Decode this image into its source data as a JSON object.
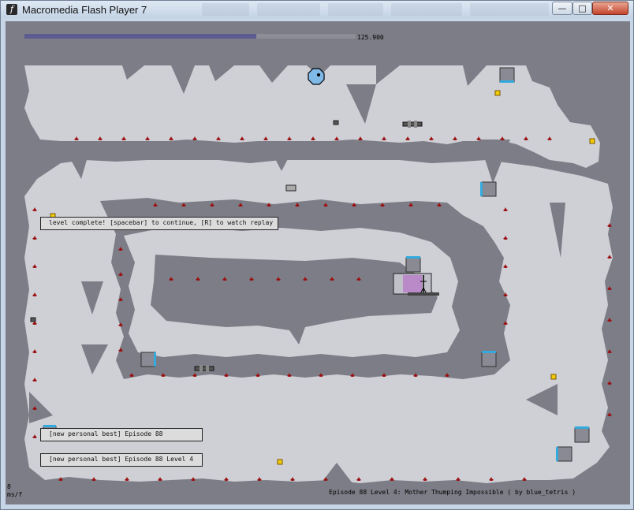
{
  "window": {
    "title": "Macromedia Flash Player 7",
    "app_icon_glyph": "f",
    "buttons": {
      "minimize": "—",
      "maximize": "□",
      "close": "✕"
    }
  },
  "hud": {
    "timer_value": "125.900",
    "time_fraction": 0.7
  },
  "messages": {
    "level_complete": "level complete! [spacebar] to continue, [R] to watch replay",
    "best_episode": "[new personal best]  Episode 88",
    "best_level": "[new personal best]  Episode 88 Level 4"
  },
  "stats": {
    "frame_ms": "8",
    "frame_unit": "ms/f"
  },
  "level": {
    "info": "Episode 88 Level 4: Mother Thumping Impossible  ( by blue_tetris )"
  },
  "colors": {
    "wall": "#7d7d87",
    "floor": "#cfcfd6",
    "gold": "#f2cb05",
    "mine": "#9a1010",
    "door_accent": "#33aadd",
    "timer_bar": "#5c5c92",
    "ninja": "#000000",
    "exit_glow": "#b87ac8"
  },
  "icons": {
    "player": "ninja-stick-figure",
    "enemy": "zap-drone",
    "collectible": "gold-square",
    "hazard": "proximity-mine",
    "door": "locked-door",
    "exit": "exit-door"
  }
}
